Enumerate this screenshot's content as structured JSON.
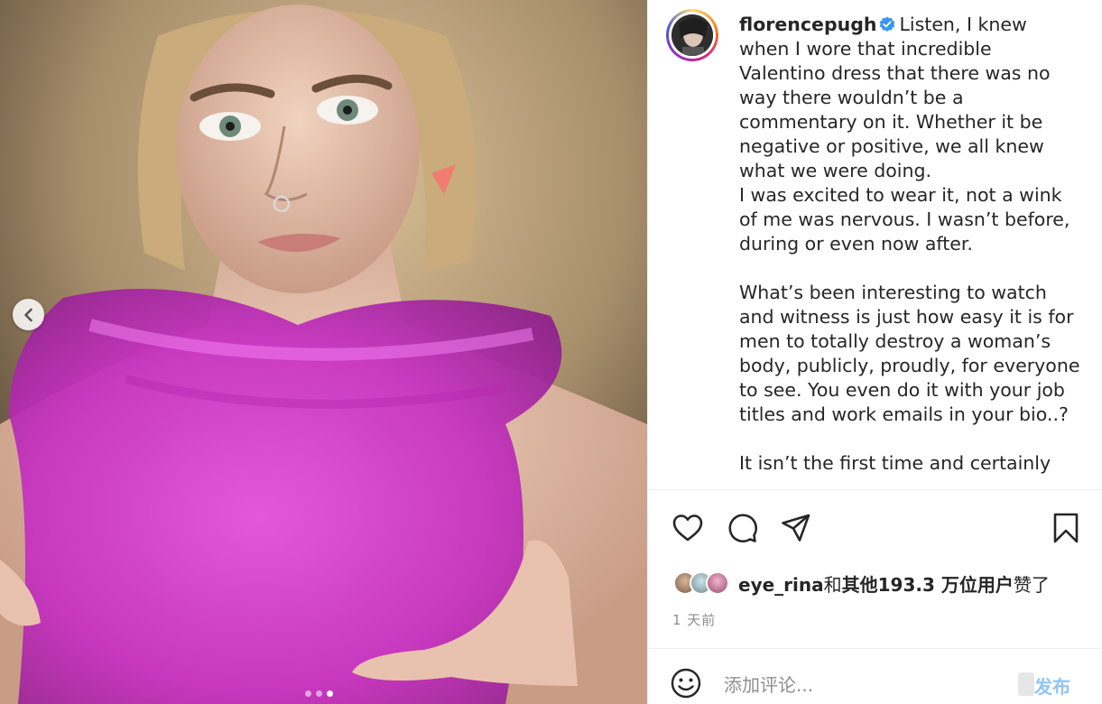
{
  "post": {
    "username": "florencepugh",
    "caption_first": "Listen, I knew when I wore that incredible Valentino dress that there was no way there wouldn’t be a commentary on it. Whether it be negative or positive, we all knew what we were doing.\nI was excited to wear it, not a wink of me was nervous. I wasn’t before, during or even now after.\n\nWhat’s been interesting to watch and witness is just how easy it is for men to totally destroy a woman’s body, publicly, proudly, for everyone to see. You even do it with your job titles and work emails in your bio..?\n\nIt isn’t the first time and certainly",
    "liked_by_user": "eye_rina",
    "liked_by_middle": "和",
    "liked_by_rest": "其他193.3 万位用户",
    "liked_by_suffix": "赞了",
    "time_ago": "1 天前"
  },
  "comment": {
    "placeholder": "添加评论...",
    "publish_label": "发布"
  },
  "carousel": {
    "count": 3,
    "active_index": 3
  },
  "icons": {
    "prev": "chevron-left-icon",
    "like": "heart-icon",
    "comment": "comment-bubble-icon",
    "share": "paper-plane-icon",
    "save": "bookmark-icon",
    "emoji": "smiley-icon",
    "verified": "verified-badge-icon"
  },
  "colors": {
    "verified": "#3897f0",
    "publish": "#8fc5f8",
    "dress": "#d63ad0"
  }
}
